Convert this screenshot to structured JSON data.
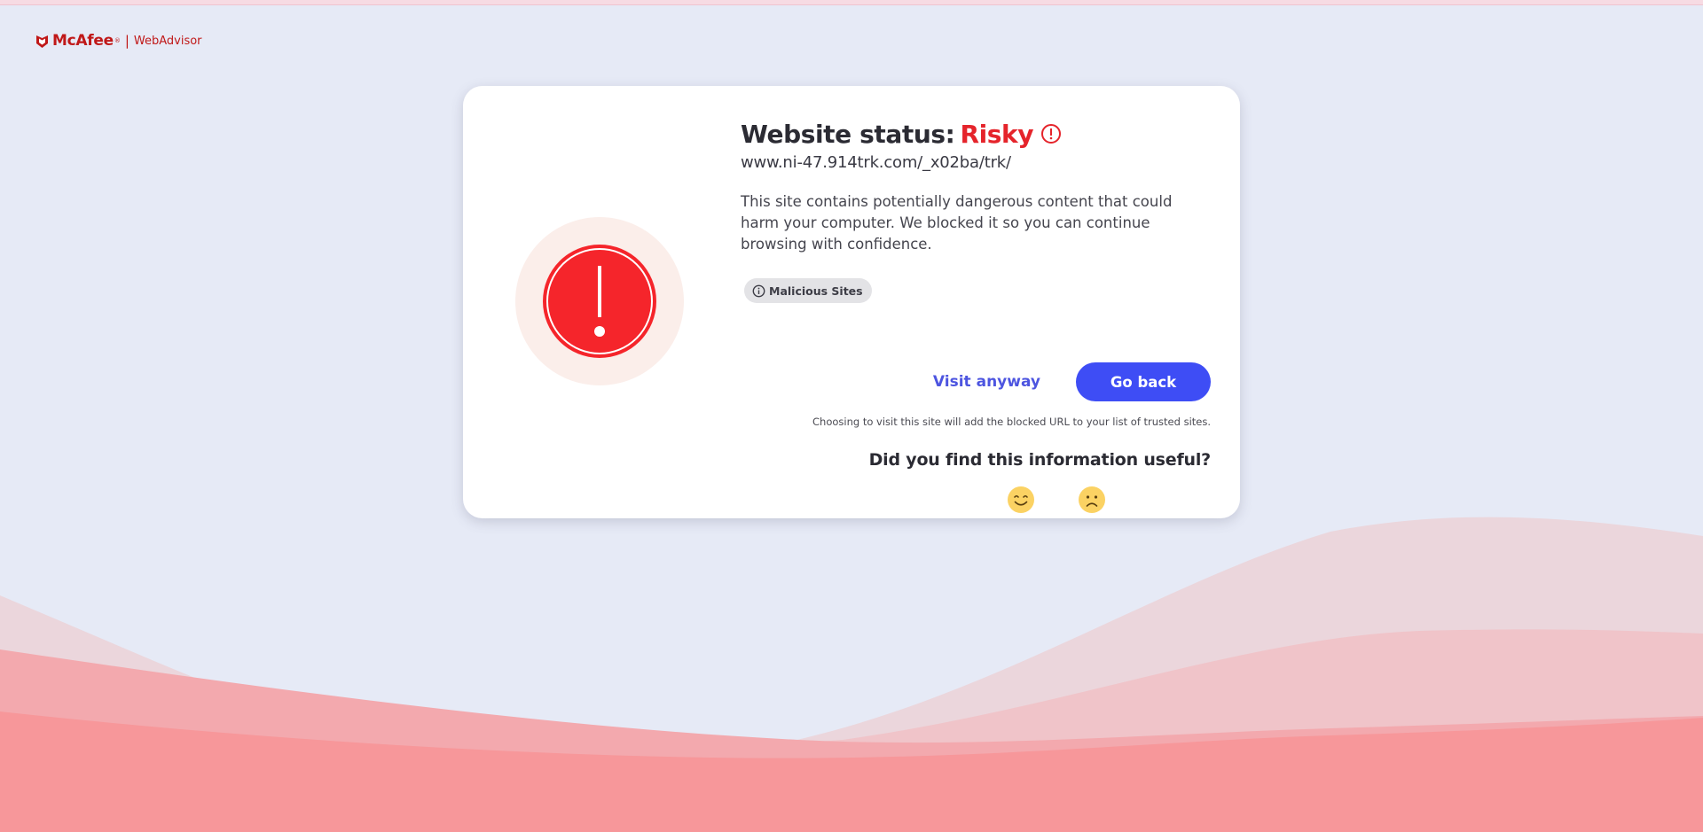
{
  "header": {
    "brand": "McAfee",
    "trademark": "®",
    "separator": "|",
    "product": "WebAdvisor"
  },
  "colors": {
    "background": "#e6eaf6",
    "danger": "#e5242b",
    "accent": "#3e4df5",
    "link": "#4d55e0",
    "brand": "#c01818"
  },
  "status": {
    "label": "Website status:",
    "level": "Risky",
    "icon": "exclamation-circle-icon"
  },
  "site": {
    "url": "www.ni-47.914trk.com/_x02ba/trk/"
  },
  "message": {
    "description": "This site contains potentially dangerous content that could harm your computer. We blocked it so you can continue browsing with confidence."
  },
  "category": {
    "label": "Malicious Sites",
    "icon": "info-icon"
  },
  "actions": {
    "visit_label": "Visit anyway",
    "back_label": "Go back",
    "note": "Choosing to visit this site will add the blocked URL to your list of trusted sites."
  },
  "feedback": {
    "question": "Did you find this information useful?",
    "options": [
      "smiling-face-icon",
      "frowning-face-icon"
    ]
  }
}
